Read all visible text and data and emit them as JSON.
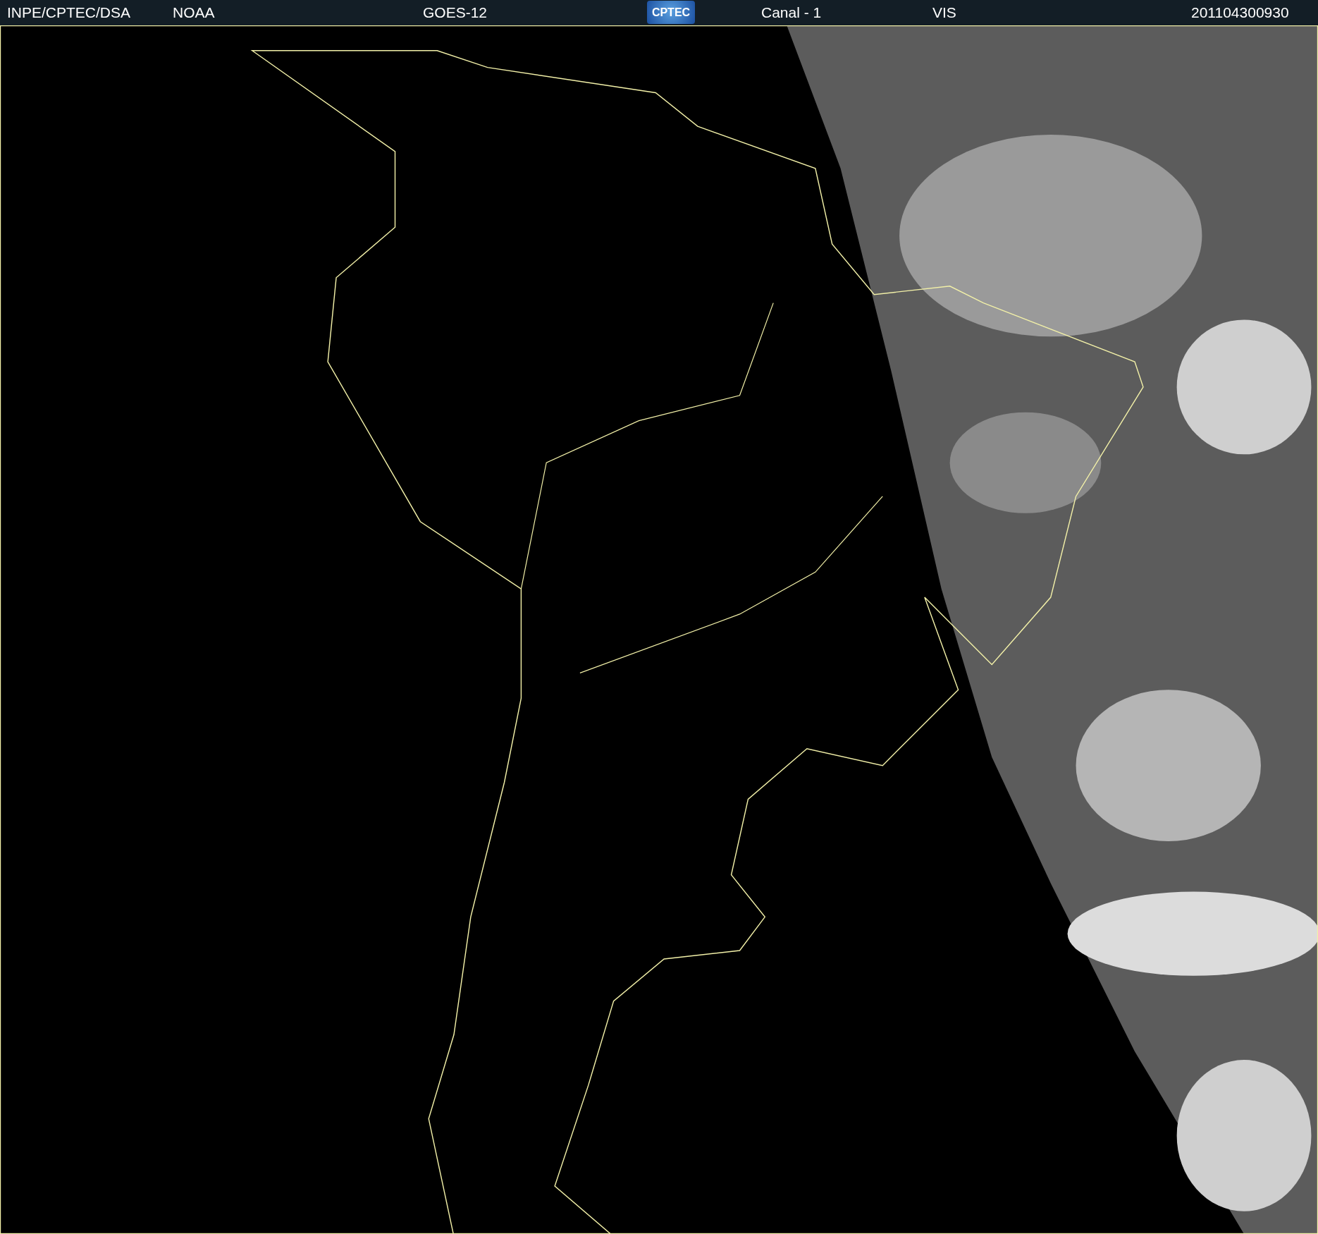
{
  "header": [
    {
      "kind": "text",
      "text": "INPE/CPTEC/DSA"
    },
    {
      "kind": "text",
      "text": "NOAA"
    },
    {
      "kind": "text",
      "text": "GOES-12"
    },
    {
      "kind": "logo",
      "text": "CPTEC"
    },
    {
      "kind": "text",
      "text": "Canal - 1"
    },
    {
      "kind": "text",
      "text": "VIS"
    },
    {
      "kind": "text",
      "text": "201104300930"
    }
  ]
}
